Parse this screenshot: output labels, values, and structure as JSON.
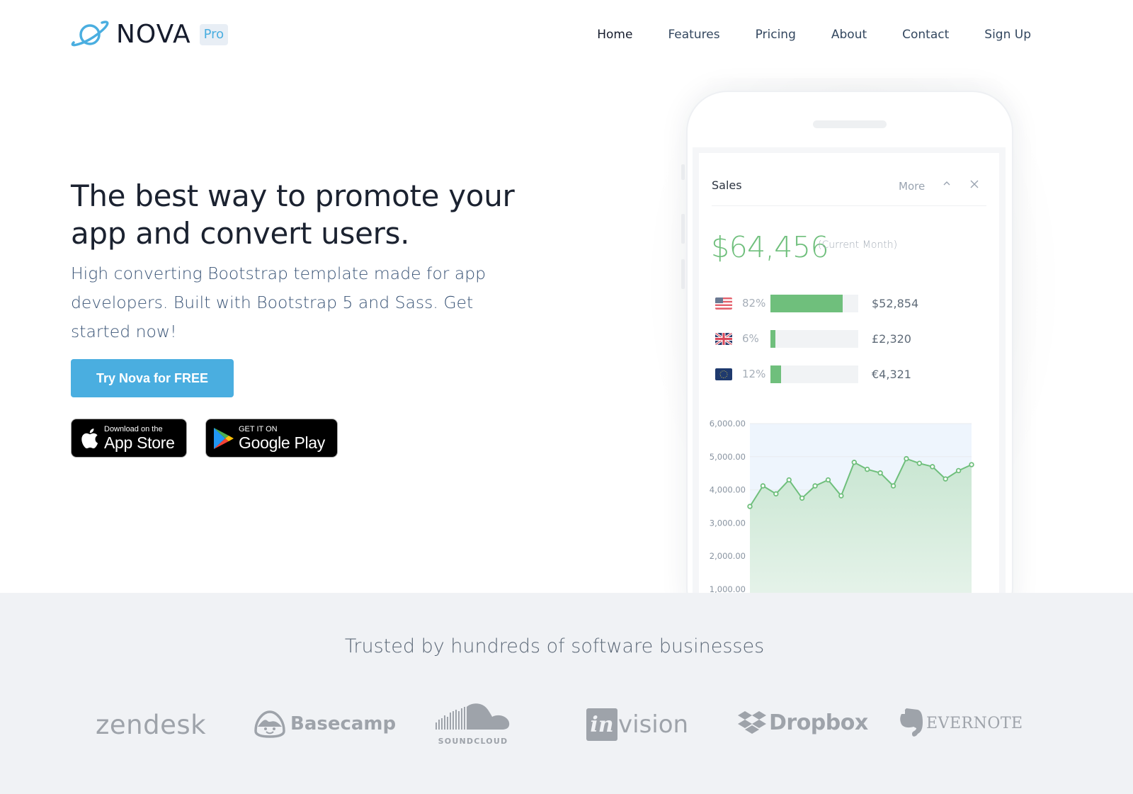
{
  "brand": {
    "name": "NOVA",
    "badge": "Pro",
    "accent": "#4aaee0"
  },
  "nav": {
    "items": [
      {
        "label": "Home",
        "active": true
      },
      {
        "label": "Features",
        "active": false
      },
      {
        "label": "Pricing",
        "active": false
      },
      {
        "label": "About",
        "active": false
      },
      {
        "label": "Contact",
        "active": false
      },
      {
        "label": "Sign Up",
        "active": false
      }
    ]
  },
  "hero": {
    "title": "The best way to promote your app and convert users.",
    "subtitle": "High converting Bootstrap template made for app developers. Built with Bootstrap 5 and Sass. Get started now!",
    "cta_label": "Try Nova for FREE",
    "app_store": {
      "small": "Download on the",
      "big": "App Store"
    },
    "google_play": {
      "small": "GET IT ON",
      "big": "Google Play"
    }
  },
  "phone": {
    "card": {
      "title": "Sales",
      "more_label": "More",
      "collapse_icon": "chevron-up-icon",
      "close_icon": "close-icon",
      "total": "$64,456",
      "total_note": "(Current Month)",
      "rows": [
        {
          "flag": "us-flag",
          "percent_label": "82%",
          "fraction": 0.82,
          "amount": "$52,854"
        },
        {
          "flag": "uk-flag",
          "percent_label": "6%",
          "fraction": 0.06,
          "amount": "£2,320"
        },
        {
          "flag": "eu-flag",
          "percent_label": "12%",
          "fraction": 0.12,
          "amount": "€4,321"
        }
      ],
      "accent": "#6fbf7c"
    }
  },
  "chart_data": {
    "type": "area",
    "title": "",
    "xlabel": "",
    "ylabel": "",
    "x": [
      1,
      2,
      3,
      4,
      5,
      6,
      7,
      8,
      9,
      10,
      11,
      12,
      13,
      14,
      15,
      16,
      17,
      18
    ],
    "series": [
      {
        "name": "Sales",
        "values": [
          3500,
          4120,
          3880,
          4300,
          3750,
          4120,
          4300,
          3820,
          4830,
          4620,
          4510,
          4120,
          4940,
          4800,
          4700,
          4330,
          4580,
          4760
        ]
      }
    ],
    "yticks": [
      "6,000.00",
      "5,000.00",
      "4,000.00",
      "3,000.00",
      "2,000.00",
      "1,000.00"
    ],
    "ylim": [
      1000,
      6000
    ],
    "grid": true,
    "line_color": "#6fbf7c"
  },
  "trusted": {
    "title": "Trusted by hundreds of software businesses",
    "logos": [
      {
        "name": "zendesk",
        "text": "zendesk"
      },
      {
        "name": "basecamp",
        "text": "Basecamp"
      },
      {
        "name": "soundcloud",
        "text": "SOUNDCLOUD"
      },
      {
        "name": "invision",
        "mark": "in",
        "text": "vision"
      },
      {
        "name": "dropbox",
        "text": "Dropbox"
      },
      {
        "name": "evernote",
        "text": "EVERNOTE"
      }
    ]
  }
}
